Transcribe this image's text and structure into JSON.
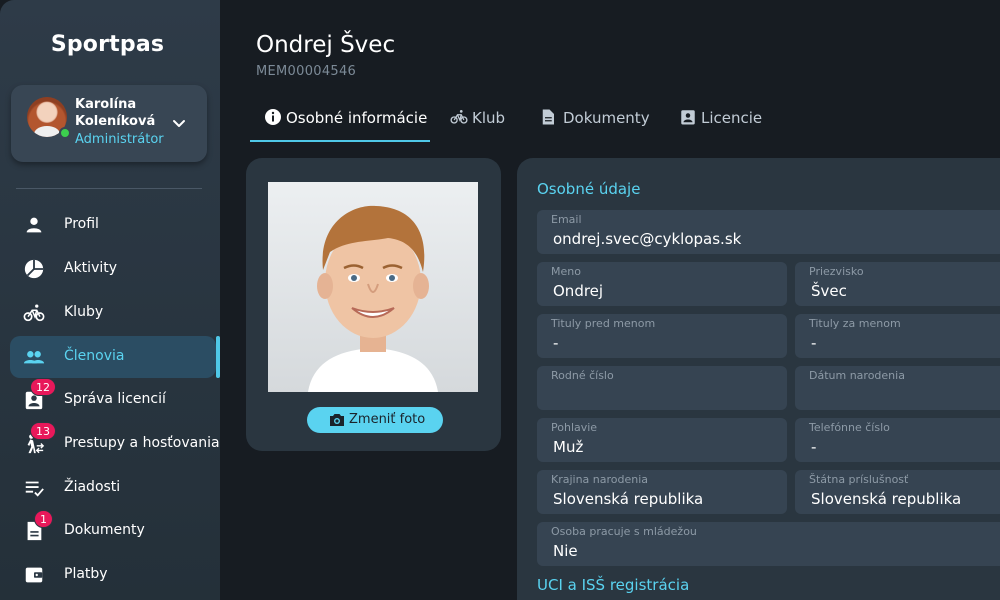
{
  "app": {
    "name": "Sportpas"
  },
  "user": {
    "name": "Karolína Koleníková",
    "role": "Administrátor"
  },
  "colors": {
    "accent": "#5ad3f0",
    "badge": "#e8185a",
    "online": "#3ccf4e"
  },
  "sidebar": {
    "items": [
      {
        "label": "Profil",
        "icon": "person-icon"
      },
      {
        "label": "Aktivity",
        "icon": "pie-chart-icon"
      },
      {
        "label": "Kluby",
        "icon": "bicycle-icon"
      },
      {
        "label": "Členovia",
        "icon": "people-icon",
        "active": true
      },
      {
        "label": "Správa licencií",
        "icon": "id-badge-icon",
        "badge": "12"
      },
      {
        "label": "Prestupy a hosťovania",
        "icon": "transfer-icon",
        "badge": "13"
      },
      {
        "label": "Žiadosti",
        "icon": "checklist-icon"
      },
      {
        "label": "Dokumenty",
        "icon": "document-icon",
        "badge": "1"
      },
      {
        "label": "Platby",
        "icon": "wallet-icon"
      }
    ]
  },
  "member": {
    "name": "Ondrej Švec",
    "id": "MEM00004546"
  },
  "tabs": [
    {
      "label": "Osobné informácie",
      "icon": "info-icon",
      "active": true
    },
    {
      "label": "Klub",
      "icon": "bicycle-icon"
    },
    {
      "label": "Dokumenty",
      "icon": "document-icon"
    },
    {
      "label": "Licencie",
      "icon": "id-badge-icon"
    }
  ],
  "photo": {
    "button_label": "Zmeniť foto"
  },
  "personal": {
    "title": "Osobné údaje",
    "email": {
      "label": "Email",
      "value": "ondrej.svec@cyklopas.sk"
    },
    "first_name": {
      "label": "Meno",
      "value": "Ondrej"
    },
    "last_name": {
      "label": "Priezvisko",
      "value": "Švec"
    },
    "title_before": {
      "label": "Tituly pred menom",
      "value": "-"
    },
    "title_after": {
      "label": "Tituly za menom",
      "value": "-"
    },
    "birth_number": {
      "label": "Rodné číslo",
      "value": ""
    },
    "birth_date": {
      "label": "Dátum narodenia",
      "value": ""
    },
    "gender": {
      "label": "Pohlavie",
      "value": "Muž"
    },
    "phone": {
      "label": "Telefónne číslo",
      "value": "-"
    },
    "birth_country": {
      "label": "Krajina narodenia",
      "value": "Slovenská republika"
    },
    "citizenship": {
      "label": "Štátna príslušnosť",
      "value": "Slovenská republika"
    },
    "youth_worker": {
      "label": "Osoba pracuje s mládežou",
      "value": "Nie"
    }
  },
  "uci": {
    "title": "UCI a ISŠ registrácia"
  }
}
